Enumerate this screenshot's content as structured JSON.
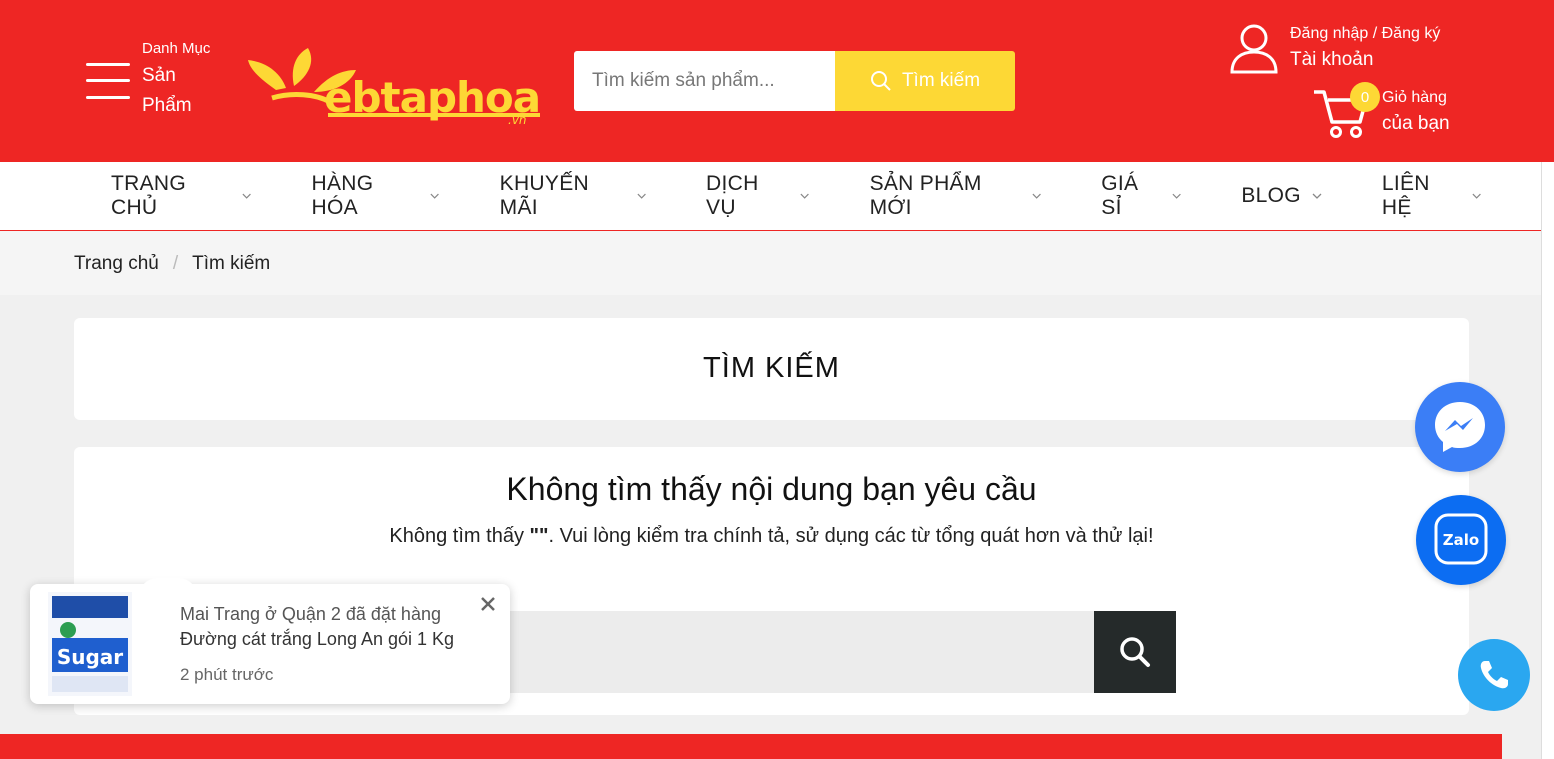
{
  "header": {
    "category": {
      "small": "Danh Mục",
      "big": "Sản Phẩm"
    },
    "logo": {
      "text": "ebtaphoa",
      "suffix": ".vn"
    },
    "search": {
      "placeholder": "Tìm kiếm sản phẩm...",
      "button_label": "Tìm kiếm"
    },
    "account": {
      "small": "Đăng nhập / Đăng ký",
      "big": "Tài khoản"
    },
    "cart": {
      "count": "0",
      "small": "Giỏ hàng",
      "big": "của bạn"
    },
    "colors": {
      "brand": "#ee2624",
      "accent": "#fdd835"
    }
  },
  "nav": {
    "items": [
      {
        "label": "TRANG CHỦ"
      },
      {
        "label": "HÀNG HÓA"
      },
      {
        "label": "KHUYẾN MÃI"
      },
      {
        "label": "DỊCH VỤ"
      },
      {
        "label": "SẢN PHẨM MỚI"
      },
      {
        "label": "GIÁ SỈ"
      },
      {
        "label": "BLOG"
      },
      {
        "label": "LIÊN HỆ"
      }
    ]
  },
  "breadcrumb": {
    "home": "Trang chủ",
    "separator": "/",
    "current": "Tìm kiếm"
  },
  "main": {
    "title": "TÌM KIẾM",
    "result_heading": "Không tìm thấy nội dung bạn yêu cầu",
    "result_msg_prefix": "Không tìm thấy ",
    "result_msg_query": "\"\"",
    "result_msg_suffix": ". Vui lòng kiểm tra chính tả, sử dụng các từ tổng quát hơn và thử lại!",
    "search_value": ""
  },
  "notification": {
    "name": "Mai Trang ở Quận 2 đã đặt hàng",
    "product": "Đường cát trắng Long An gói 1 Kg",
    "time": "2 phút trước",
    "image_text": "Sugar"
  },
  "floating": {
    "messenger": "messenger-icon",
    "zalo": "Zalo",
    "phone": "phone-icon"
  }
}
